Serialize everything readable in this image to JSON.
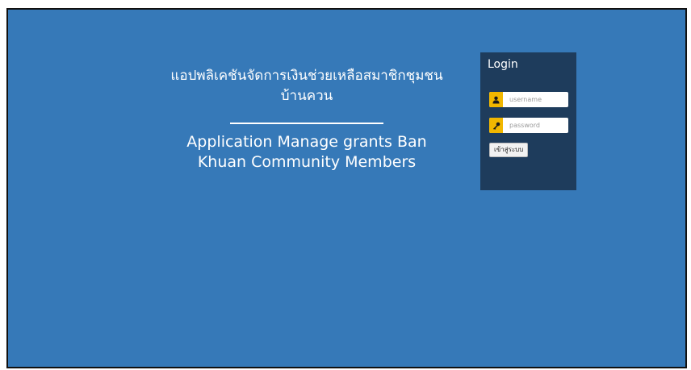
{
  "hero": {
    "title_th_line1": "แอปพลิเคชันจัดการเงินช่วยเหลือสมาชิกชุมชน",
    "title_th_line2": "บ้านควน",
    "title_en_line1": "Application Manage grants Ban",
    "title_en_line2": "Khuan Community Members"
  },
  "login": {
    "title": "Login",
    "username_placeholder": "username",
    "password_placeholder": "password",
    "submit_label": "เข้าสู่ระบบ",
    "username_icon": "user-icon",
    "password_icon": "key-icon"
  },
  "colors": {
    "background": "#3679b8",
    "panel": "#1e3c5c",
    "icon_accent": "#f1b700"
  }
}
